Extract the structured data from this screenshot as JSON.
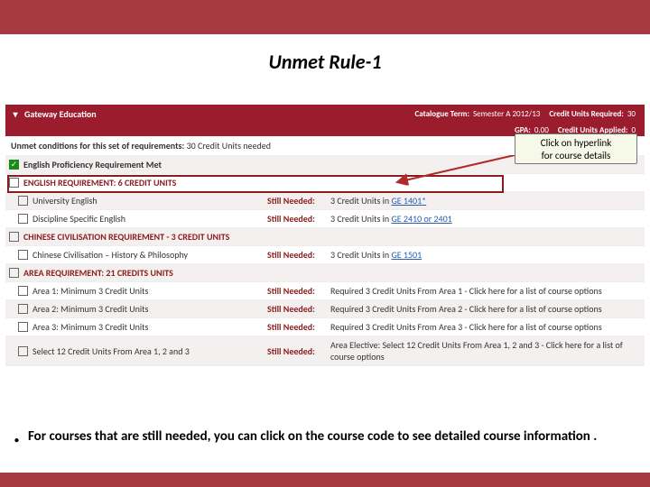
{
  "title": "Unmet Rule-1",
  "callout": {
    "line1": "Click on hyperlink",
    "line2": "for course details"
  },
  "header": {
    "section": "Gateway Education",
    "cat_term_label": "Catalogue Term:",
    "cat_term_value": "Semester A 2012/13",
    "req_label": "Credit Units Required:",
    "req_value": "30",
    "gpa_label": "GPA:",
    "gpa_value": "0.00",
    "applied_label": "Credit Units Applied:",
    "applied_value": "0"
  },
  "unmet_conditions": {
    "label": "Unmet conditions for this set of requirements:",
    "text": "30 Credit Units needed"
  },
  "rows": {
    "r1": {
      "label": "English Proficiency Requirement Met"
    },
    "r2": {
      "label": "ENGLISH REQUIREMENT: 6 CREDIT UNITS"
    },
    "r3": {
      "label": "University English",
      "still": "Still Needed:",
      "need_prefix": "3 Credit Units in ",
      "link": "GE 1401*"
    },
    "r4": {
      "label": "Discipline Specific English",
      "still": "Still Needed:",
      "need_prefix": "3 Credit Units in ",
      "link": "GE 2410 or 2401"
    },
    "r5": {
      "label": "CHINESE CIVILISATION REQUIREMENT - 3 CREDIT UNITS"
    },
    "r6": {
      "label": "Chinese Civilisation – History & Philosophy",
      "still": "Still Needed:",
      "need_prefix": "3 Credit Units in ",
      "link": "GE 1501"
    },
    "r7": {
      "label": "AREA REQUIREMENT: 21 CREDITS UNITS"
    },
    "r8": {
      "label": "Area 1: Minimum 3 Credit Units",
      "still": "Still Needed:",
      "need": "Required 3 Credit Units From Area 1 - Click here for a list of course options"
    },
    "r9": {
      "label": "Area 2: Minimum 3 Credit Units",
      "still": "Still Needed:",
      "need": "Required 3 Credit Units From Area 2 - Click here for a list of course options"
    },
    "r10": {
      "label": "Area 3: Minimum 3 Credit Units",
      "still": "Still Needed:",
      "need": "Required 3 Credit Units From Area 3 - Click here for a list of course options"
    },
    "r11": {
      "label": "Select 12 Credit Units From Area 1, 2 and 3",
      "still": "Still Needed:",
      "need": "Area Elective: Select 12 Credit Units From Area 1, 2 and 3 - Click here for a list of course options"
    }
  },
  "bullet": "For courses that are still needed, you can click on the course code to see detailed course information ."
}
